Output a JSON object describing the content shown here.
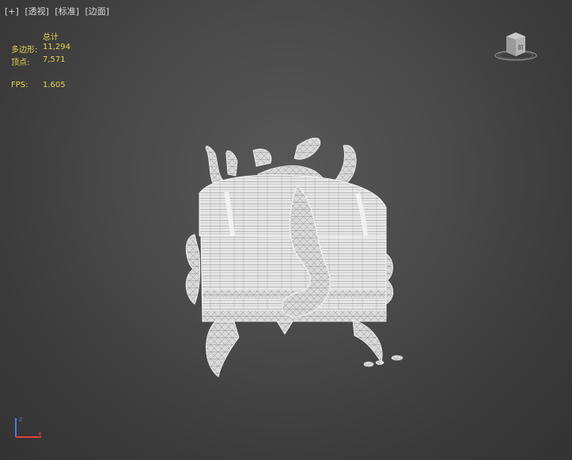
{
  "viewport": {
    "labels": {
      "plus": "[+]",
      "view": "[透视]",
      "shading": "[标准]",
      "display": "[边面]"
    },
    "stats": {
      "header": "总计",
      "polygons_label": "多边形:",
      "polygons_value": "11,294",
      "vertices_label": "顶点:",
      "vertices_value": "7,571",
      "fps_label": "FPS:",
      "fps_value": "1.605"
    },
    "viewcube": {
      "face_label": "前"
    },
    "colors": {
      "stats_text": "#e5d34a",
      "label_text": "#d8d8d8",
      "background": "#4a4a4a",
      "wireframe": "#f2f2f2",
      "axis_z": "#4a7be0",
      "axis_x": "#e04040"
    },
    "icons": {
      "viewcube": "viewcube-icon",
      "axis": "axis-tripod-icon"
    }
  }
}
